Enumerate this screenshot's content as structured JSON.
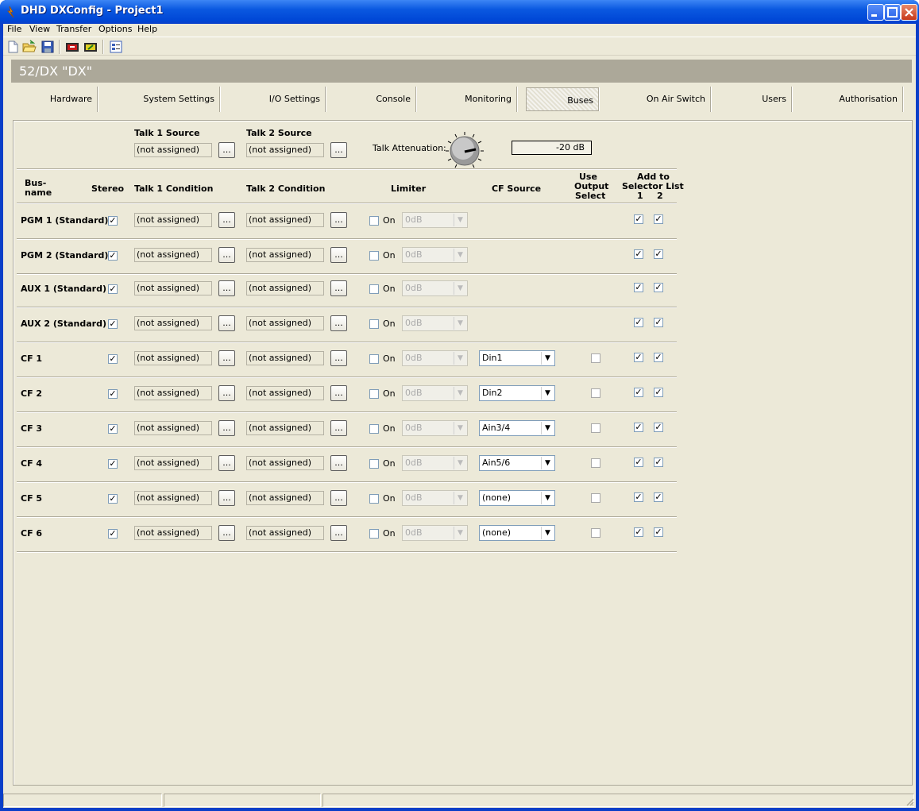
{
  "window": {
    "title": "DHD DXConfig - Project1"
  },
  "menu": [
    "File",
    "View",
    "Transfer",
    "Options",
    "Help"
  ],
  "device": {
    "name": "52/DX \"DX\""
  },
  "tabs": [
    "Hardware",
    "System Settings",
    "I/O Settings",
    "Console",
    "Monitoring",
    "Buses",
    "On Air Switch",
    "Users",
    "Authorisation"
  ],
  "selected_tab": "Buses",
  "talk": {
    "source1_label": "Talk 1 Source",
    "source2_label": "Talk 2 Source",
    "source1": "(not assigned)",
    "source2": "(not assigned)",
    "attenuation_label": "Talk Attenuation:",
    "attenuation_value": "-20 dB"
  },
  "headers": {
    "busname1": "Bus-",
    "busname2": "name",
    "stereo": "Stereo",
    "talk1": "Talk 1 Condition",
    "talk2": "Talk 2 Condition",
    "limiter": "Limiter",
    "cf_source": "CF Source",
    "use1": "Use",
    "use2": "Output",
    "use3": "Select",
    "add1": "Add to",
    "add2": "Selector List",
    "add3": "1",
    "add4": "2"
  },
  "dots": "...",
  "on_label": "On",
  "buses": [
    {
      "name": "PGM 1 (Standard)",
      "stereo": true,
      "talk1": "(not assigned)",
      "talk2": "(not assigned)",
      "limiter_on": false,
      "limiter": "0dB",
      "cf_source": null,
      "use_output": null,
      "sel1": true,
      "sel2": true
    },
    {
      "name": "PGM 2 (Standard)",
      "stereo": true,
      "talk1": "(not assigned)",
      "talk2": "(not assigned)",
      "limiter_on": false,
      "limiter": "0dB",
      "cf_source": null,
      "use_output": null,
      "sel1": true,
      "sel2": true
    },
    {
      "name": "AUX 1 (Standard)",
      "stereo": true,
      "talk1": "(not assigned)",
      "talk2": "(not assigned)",
      "limiter_on": false,
      "limiter": "0dB",
      "cf_source": null,
      "use_output": null,
      "sel1": true,
      "sel2": true
    },
    {
      "name": "AUX 2 (Standard)",
      "stereo": true,
      "talk1": "(not assigned)",
      "talk2": "(not assigned)",
      "limiter_on": false,
      "limiter": "0dB",
      "cf_source": null,
      "use_output": null,
      "sel1": true,
      "sel2": true
    },
    {
      "name": "CF 1",
      "stereo": true,
      "talk1": "(not assigned)",
      "talk2": "(not assigned)",
      "limiter_on": false,
      "limiter": "0dB",
      "cf_source": "Din1",
      "use_output": false,
      "sel1": true,
      "sel2": true
    },
    {
      "name": "CF 2",
      "stereo": true,
      "talk1": "(not assigned)",
      "talk2": "(not assigned)",
      "limiter_on": false,
      "limiter": "0dB",
      "cf_source": "Din2",
      "use_output": false,
      "sel1": true,
      "sel2": true
    },
    {
      "name": "CF 3",
      "stereo": true,
      "talk1": "(not assigned)",
      "talk2": "(not assigned)",
      "limiter_on": false,
      "limiter": "0dB",
      "cf_source": "Ain3/4",
      "use_output": false,
      "sel1": true,
      "sel2": true
    },
    {
      "name": "CF 4",
      "stereo": true,
      "talk1": "(not assigned)",
      "talk2": "(not assigned)",
      "limiter_on": false,
      "limiter": "0dB",
      "cf_source": "Ain5/6",
      "use_output": false,
      "sel1": true,
      "sel2": true
    },
    {
      "name": "CF 5",
      "stereo": true,
      "talk1": "(not assigned)",
      "talk2": "(not assigned)",
      "limiter_on": false,
      "limiter": "0dB",
      "cf_source": "(none)",
      "use_output": false,
      "sel1": true,
      "sel2": true
    },
    {
      "name": "CF 6",
      "stereo": true,
      "talk1": "(not assigned)",
      "talk2": "(not assigned)",
      "limiter_on": false,
      "limiter": "0dB",
      "cf_source": "(none)",
      "use_output": false,
      "sel1": true,
      "sel2": true
    }
  ],
  "colors": {
    "titlebar": "#0a58e0",
    "face": "#ece9d8",
    "devbar": "#aca899"
  }
}
